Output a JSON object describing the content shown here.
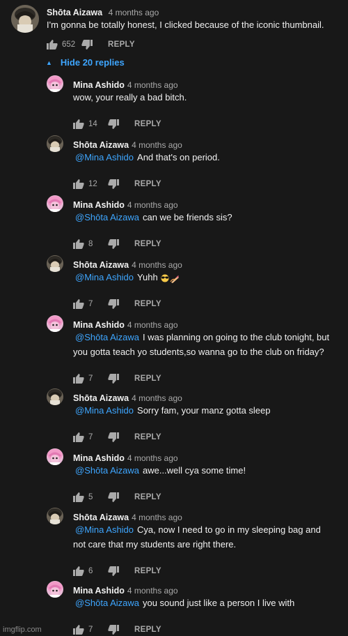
{
  "top_comment": {
    "author": "Shōta Aizawa",
    "time": "4 months ago",
    "text": "I'm gonna be totally honest, I clicked because of the iconic thumbnail.",
    "likes": "652",
    "reply_label": "REPLY",
    "avatar_icon": "aizawa-avatar-icon"
  },
  "hide_replies": {
    "label": "Hide 20 replies",
    "icon": "caret-up-icon"
  },
  "replies": [
    {
      "author": "Mina Ashido",
      "time": "4 months ago",
      "mention": "",
      "lines": [
        "wow, your really a bad bitch."
      ],
      "likes": "14",
      "reply_label": "REPLY",
      "avatar_icon": "mina-avatar-icon"
    },
    {
      "author": "Shōta Aizawa",
      "time": "4 months ago",
      "mention": "@Mina Ashido",
      "lines": [
        "And that's on period."
      ],
      "likes": "12",
      "reply_label": "REPLY",
      "avatar_icon": "aizawa-avatar-icon"
    },
    {
      "author": "Mina Ashido",
      "time": "4 months ago",
      "mention": "@Shōta Aizawa",
      "lines": [
        "can we be friends sis?"
      ],
      "likes": "8",
      "reply_label": "REPLY",
      "avatar_icon": "mina-avatar-icon"
    },
    {
      "author": "Shōta Aizawa",
      "time": "4 months ago",
      "mention": "@Mina Ashido",
      "lines": [
        "Yuhh"
      ],
      "emoji": [
        "sunglasses-emoji",
        "nail-polish-emoji"
      ],
      "likes": "7",
      "reply_label": "REPLY",
      "avatar_icon": "aizawa-avatar-icon"
    },
    {
      "author": "Mina Ashido",
      "time": "4 months ago",
      "mention": "@Shōta Aizawa",
      "lines": [
        "I was planning on going to the club tonight, but",
        "you gotta teach yo students,so wanna go to the club on friday?"
      ],
      "likes": "7",
      "reply_label": "REPLY",
      "avatar_icon": "mina-avatar-icon"
    },
    {
      "author": "Shōta Aizawa",
      "time": "4 months ago",
      "mention": "@Mina Ashido",
      "lines": [
        "Sorry fam, your manz gotta sleep"
      ],
      "likes": "7",
      "reply_label": "REPLY",
      "avatar_icon": "aizawa-avatar-icon"
    },
    {
      "author": "Mina Ashido",
      "time": "4 months ago",
      "mention": "@Shōta Aizawa",
      "lines": [
        "awe...well cya some time!"
      ],
      "likes": "5",
      "reply_label": "REPLY",
      "avatar_icon": "mina-avatar-icon"
    },
    {
      "author": "Shōta Aizawa",
      "time": "4 months ago",
      "mention": "@Mina Ashido",
      "lines": [
        "Cya, now I need to go in my sleeping bag and",
        "not care that my students are right there."
      ],
      "likes": "6",
      "reply_label": "REPLY",
      "avatar_icon": "aizawa-avatar-icon"
    },
    {
      "author": "Mina Ashido",
      "time": "4 months ago",
      "mention": "@Shōta Aizawa",
      "lines": [
        "you sound just like a person I live with"
      ],
      "likes": "7",
      "reply_label": "REPLY",
      "avatar_icon": "mina-avatar-icon"
    }
  ],
  "watermark": "imgflip.com",
  "colors": {
    "background": "#181818",
    "text": "#f1f1f1",
    "secondary": "#aaaaaa",
    "link": "#3ea6ff"
  }
}
